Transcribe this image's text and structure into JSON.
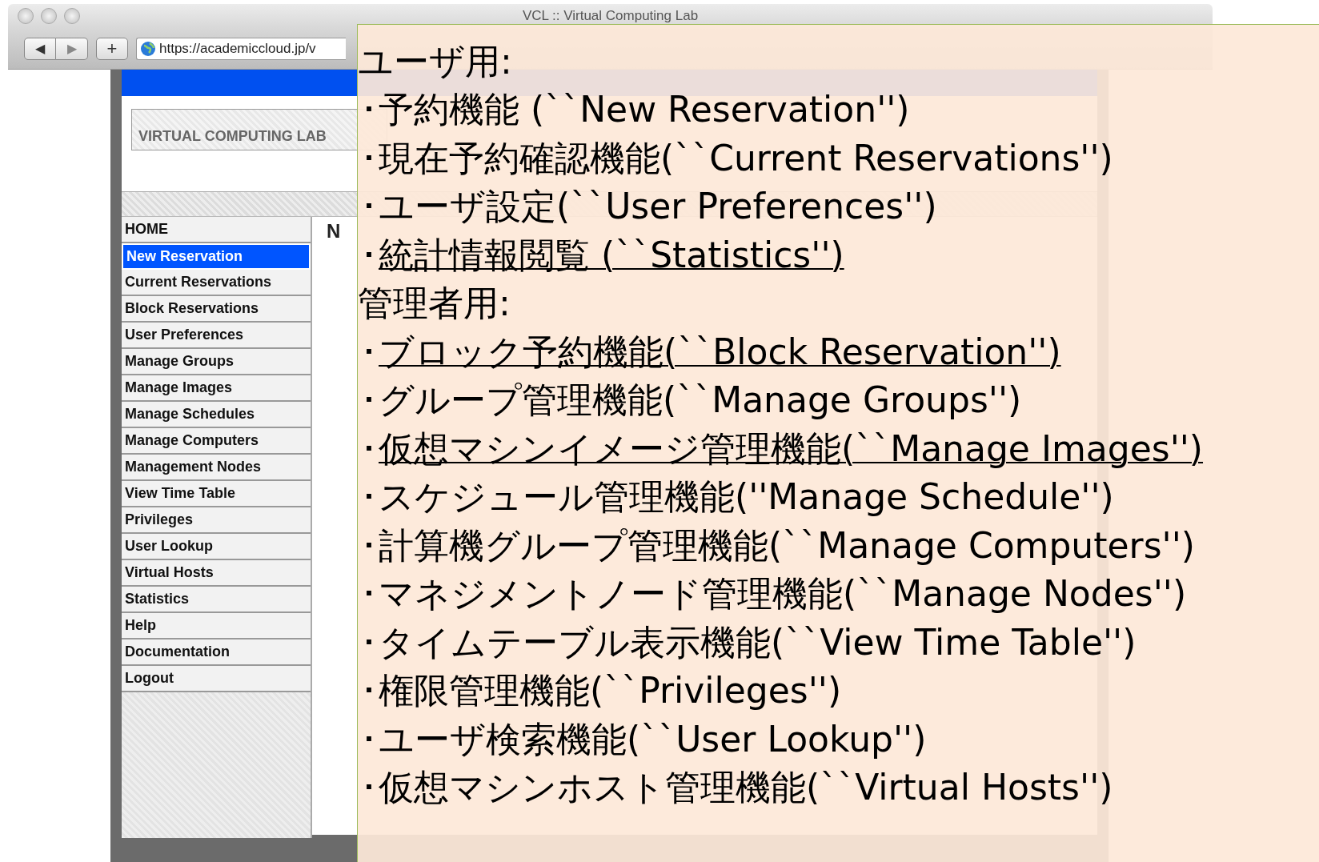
{
  "window": {
    "title": "VCL :: Virtual Computing Lab"
  },
  "toolbar": {
    "back": "◀",
    "forward": "▶",
    "add": "+",
    "url": "https://academiccloud.jp/v"
  },
  "header": {
    "logo": "VIRTUAL COMPUTING LAB"
  },
  "nav": [
    {
      "label": "HOME",
      "selected": false
    },
    {
      "label": "New Reservation",
      "selected": true
    },
    {
      "label": "Current Reservations",
      "selected": false
    },
    {
      "label": "Block Reservations",
      "selected": false
    },
    {
      "label": "User Preferences",
      "selected": false
    },
    {
      "label": "Manage Groups",
      "selected": false
    },
    {
      "label": "Manage Images",
      "selected": false
    },
    {
      "label": "Manage Schedules",
      "selected": false
    },
    {
      "label": "Manage Computers",
      "selected": false
    },
    {
      "label": "Management Nodes",
      "selected": false
    },
    {
      "label": "View Time Table",
      "selected": false
    },
    {
      "label": "Privileges",
      "selected": false
    },
    {
      "label": "User Lookup",
      "selected": false
    },
    {
      "label": "Virtual Hosts",
      "selected": false
    },
    {
      "label": "Statistics",
      "selected": false
    },
    {
      "label": "Help",
      "selected": false
    },
    {
      "label": "Documentation",
      "selected": false
    },
    {
      "label": "Logout",
      "selected": false
    }
  ],
  "form": {
    "title": "N"
  },
  "overlay": [
    {
      "heading": "ユーザ用:",
      "items": [
        {
          "bullet": "･",
          "text": "予約機能 (``New Reservation'')",
          "underlined": false
        },
        {
          "bullet": "･",
          "text": "現在予約確認機能(``Current Reservations'')",
          "underlined": false
        },
        {
          "bullet": "･",
          "text": "ユーザ設定(``User Preferences'')",
          "underlined": false
        },
        {
          "bullet": "･",
          "text": "統計情報閲覧 (``Statistics'')",
          "underlined": true
        }
      ]
    },
    {
      "heading": "管理者用:",
      "items": [
        {
          "bullet": "･",
          "text": "ブロック予約機能(``Block Reservation'')",
          "underlined": true
        },
        {
          "bullet": "･",
          "text": "グループ管理機能(``Manage Groups'')",
          "underlined": false
        },
        {
          "bullet": "･",
          "text": "仮想マシンイメージ管理機能(``Manage Images'')",
          "underlined": true
        },
        {
          "bullet": "･",
          "text": "スケジュール管理機能(''Manage Schedule'')",
          "underlined": false
        },
        {
          "bullet": "･",
          "text": "計算機グループ管理機能(``Manage Computers'')",
          "underlined": false
        },
        {
          "bullet": "･",
          "text": "マネジメントノード管理機能(``Manage Nodes'')",
          "underlined": false
        },
        {
          "bullet": "･",
          "text": "タイムテーブル表示機能(``View Time Table'')",
          "underlined": false
        },
        {
          "bullet": "･",
          "text": "権限管理機能(``Privileges'')",
          "underlined": false
        },
        {
          "bullet": "･",
          "text": "ユーザ検索機能(``User Lookup'')",
          "underlined": false
        },
        {
          "bullet": "･",
          "text": "仮想マシンホスト管理機能(``Virtual Hosts'')",
          "underlined": false
        }
      ]
    }
  ]
}
